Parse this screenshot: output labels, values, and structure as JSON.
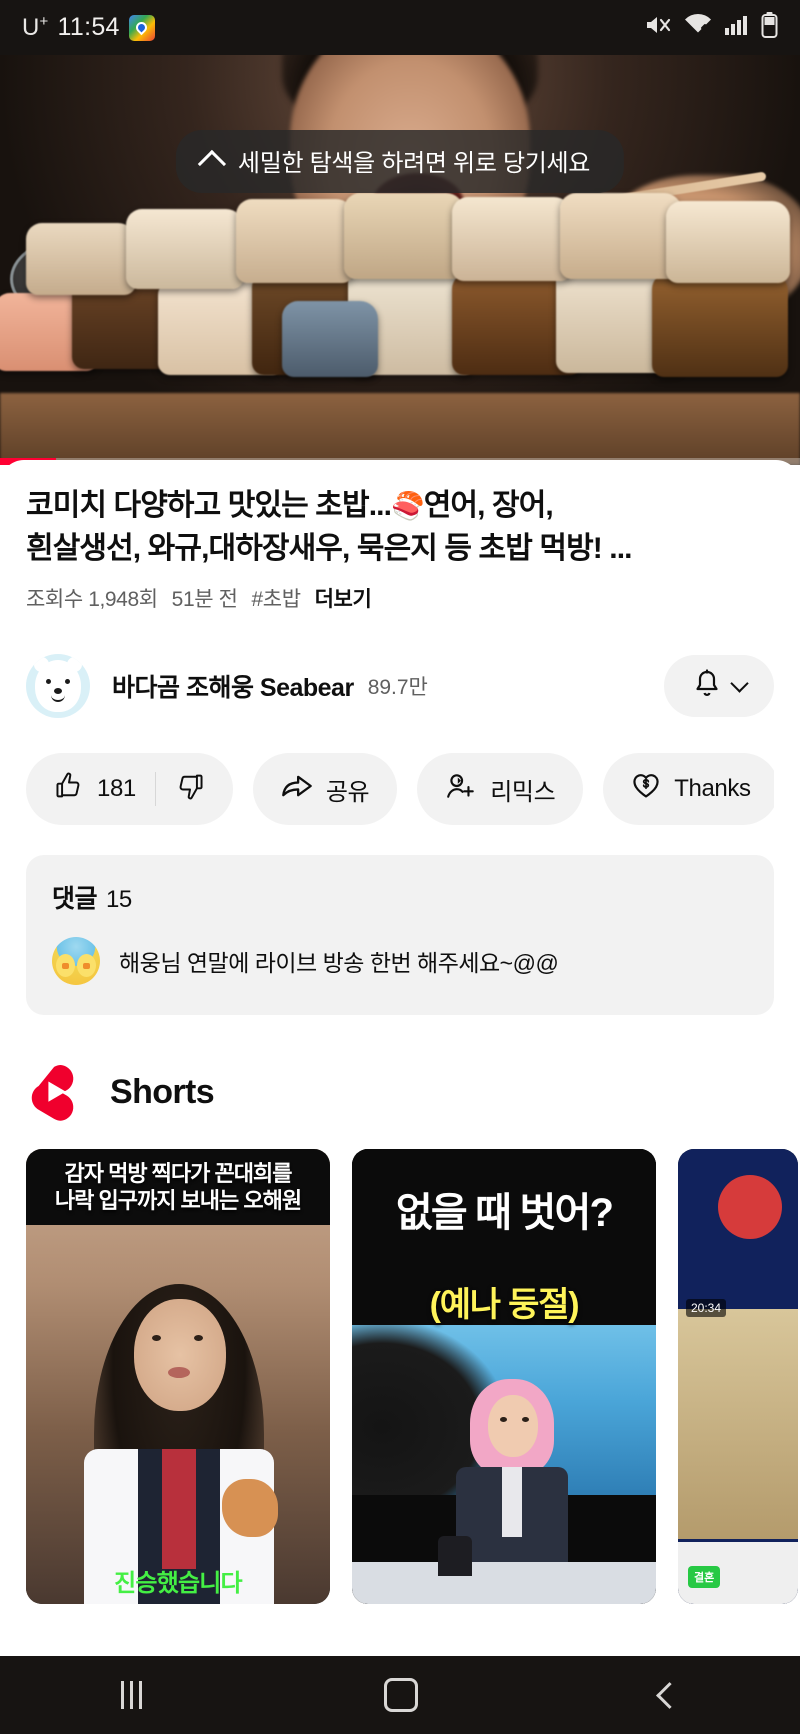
{
  "status_bar": {
    "carrier": "U",
    "carrier_sup": "+",
    "time": "11:54",
    "icons": [
      "maps-icon",
      "mute-icon",
      "wifi-icon",
      "signal-icon",
      "battery-icon"
    ]
  },
  "player": {
    "banner_text": "세밀한 탐색을 하려면 위로 당기세요",
    "banner_icon": "chevron-up-icon",
    "progress_percent": 7
  },
  "video": {
    "title_line1": "코미치 다양하고 맛있는 초밥...",
    "title_emoji": "🍣",
    "title_line1b": "연어, 장어,",
    "title_line2": "흰살생선, 와규,대하장새우, 묵은지 등 초밥 먹방! ...",
    "views": "조회수 1,948회",
    "age": "51분 전",
    "hashtag": "#초밥",
    "more_label": "더보기"
  },
  "channel": {
    "name": "바다곰 조해웅 Seabear",
    "subscribers": "89.7만",
    "avatar_name": "seabear-avatar",
    "bell_icon": "bell-icon",
    "chevron_icon": "chevron-down-icon"
  },
  "actions": [
    {
      "name": "like",
      "icon": "thumbs-up-icon",
      "label": "181",
      "has_dislike": true,
      "dislike_icon": "thumbs-down-icon"
    },
    {
      "name": "share",
      "icon": "share-arrow-icon",
      "label": "공유"
    },
    {
      "name": "remix",
      "icon": "remix-icon",
      "label": "리믹스"
    },
    {
      "name": "thanks",
      "icon": "thanks-heart-dollar-icon",
      "label": "Thanks"
    },
    {
      "name": "download",
      "icon": "download-icon",
      "label": ""
    }
  ],
  "comments": {
    "header_label": "댓글",
    "count": "15",
    "top_comment": {
      "avatar_name": "commenter-avatar",
      "text": "해웅님 연말에 라이브 방송 한번 해주세요~@@"
    }
  },
  "shorts": {
    "section_title": "Shorts",
    "logo_name": "shorts-logo-icon",
    "items": [
      {
        "caption_line1": "감자 먹방 찍다가 꼰대희를",
        "caption_line2": "나락 입구까지 보내는 오해원",
        "bottom_text": "진승했습니다"
      },
      {
        "caption": "없을 때 벗어?",
        "subtitle": "(예나 둥절)"
      },
      {
        "badge": "20:34",
        "badge2": "결혼"
      }
    ]
  },
  "navbar": {
    "recents_label": "recents-button",
    "home_label": "home-button",
    "back_label": "back-button"
  },
  "colors": {
    "accent_red": "#ff0033",
    "shorts_red": "#f0002d",
    "chip_bg": "#f2f2f2",
    "text_primary": "#0f0f0f",
    "text_secondary": "#606060"
  }
}
